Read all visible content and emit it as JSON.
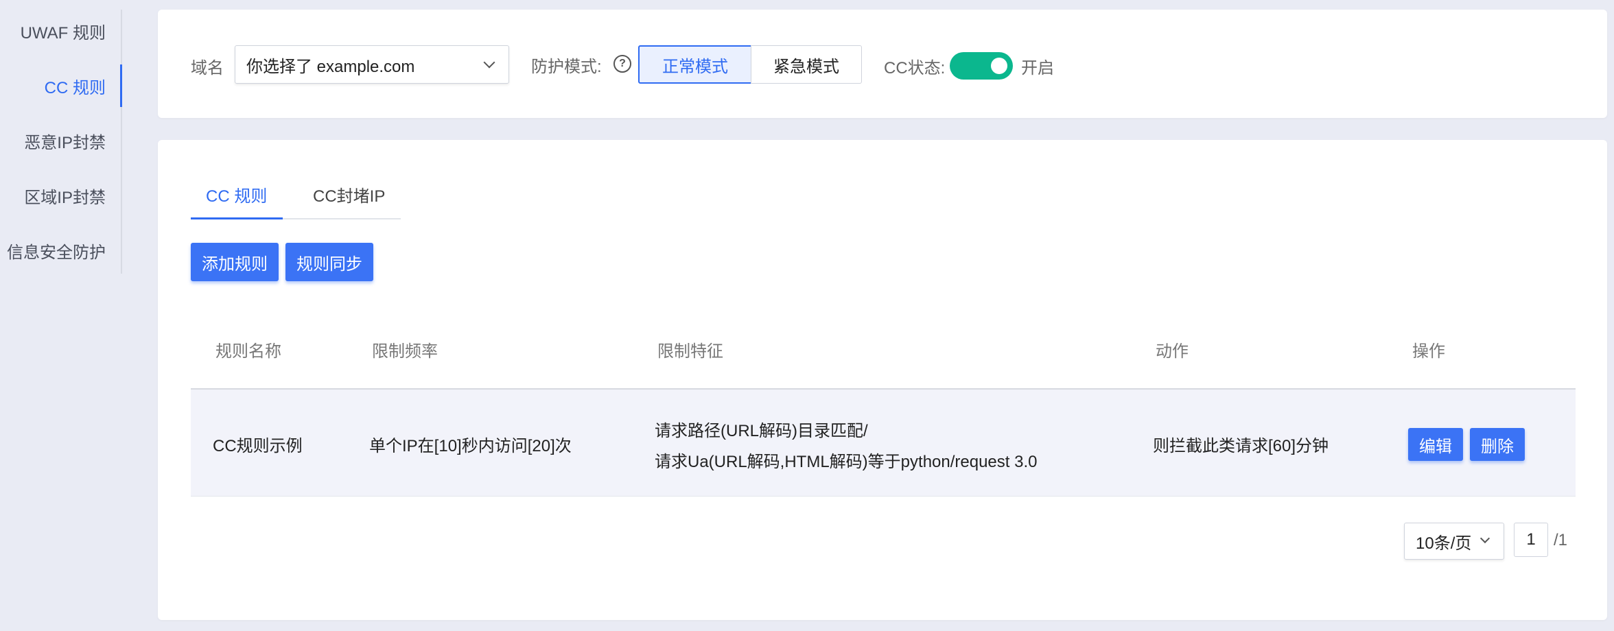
{
  "sidebar": {
    "items": [
      {
        "label": "UWAF 规则"
      },
      {
        "label": "CC 规则"
      },
      {
        "label": "恶意IP封禁"
      },
      {
        "label": "区域IP封禁"
      },
      {
        "label": "信息安全防护"
      }
    ],
    "active_index": 1
  },
  "filter": {
    "domain_label": "域名",
    "domain_value": "你选择了 example.com",
    "mode_label": "防护模式:",
    "help_glyph": "?",
    "mode_normal": "正常模式",
    "mode_urgent": "紧急模式",
    "mode_selected": "正常模式",
    "cc_status_label": "CC状态:",
    "cc_status_on": true,
    "cc_status_text": "开启"
  },
  "tabs": [
    {
      "label": "CC 规则",
      "active": true
    },
    {
      "label": "CC封堵IP",
      "active": false
    }
  ],
  "actions": {
    "add": "添加规则",
    "sync": "规则同步"
  },
  "table": {
    "headers": [
      "规则名称",
      "限制频率",
      "限制特征",
      "动作",
      "操作"
    ],
    "rows": [
      {
        "name": "CC规则示例",
        "rate": "单个IP在[10]秒内访问[20]次",
        "feature_line1": "请求路径(URL解码)目录匹配/",
        "feature_line2": "请求Ua(URL解码,HTML解码)等于python/request 3.0",
        "action": "则拦截此类请求[60]分钟",
        "edit": "编辑",
        "delete": "删除"
      }
    ]
  },
  "pagination": {
    "page_size": "10条/页",
    "current_page": "1",
    "total": "/1"
  },
  "colors": {
    "accent": "#2f6bf2",
    "toggle_on": "#0bb78e",
    "background": "#e9ebf4"
  }
}
